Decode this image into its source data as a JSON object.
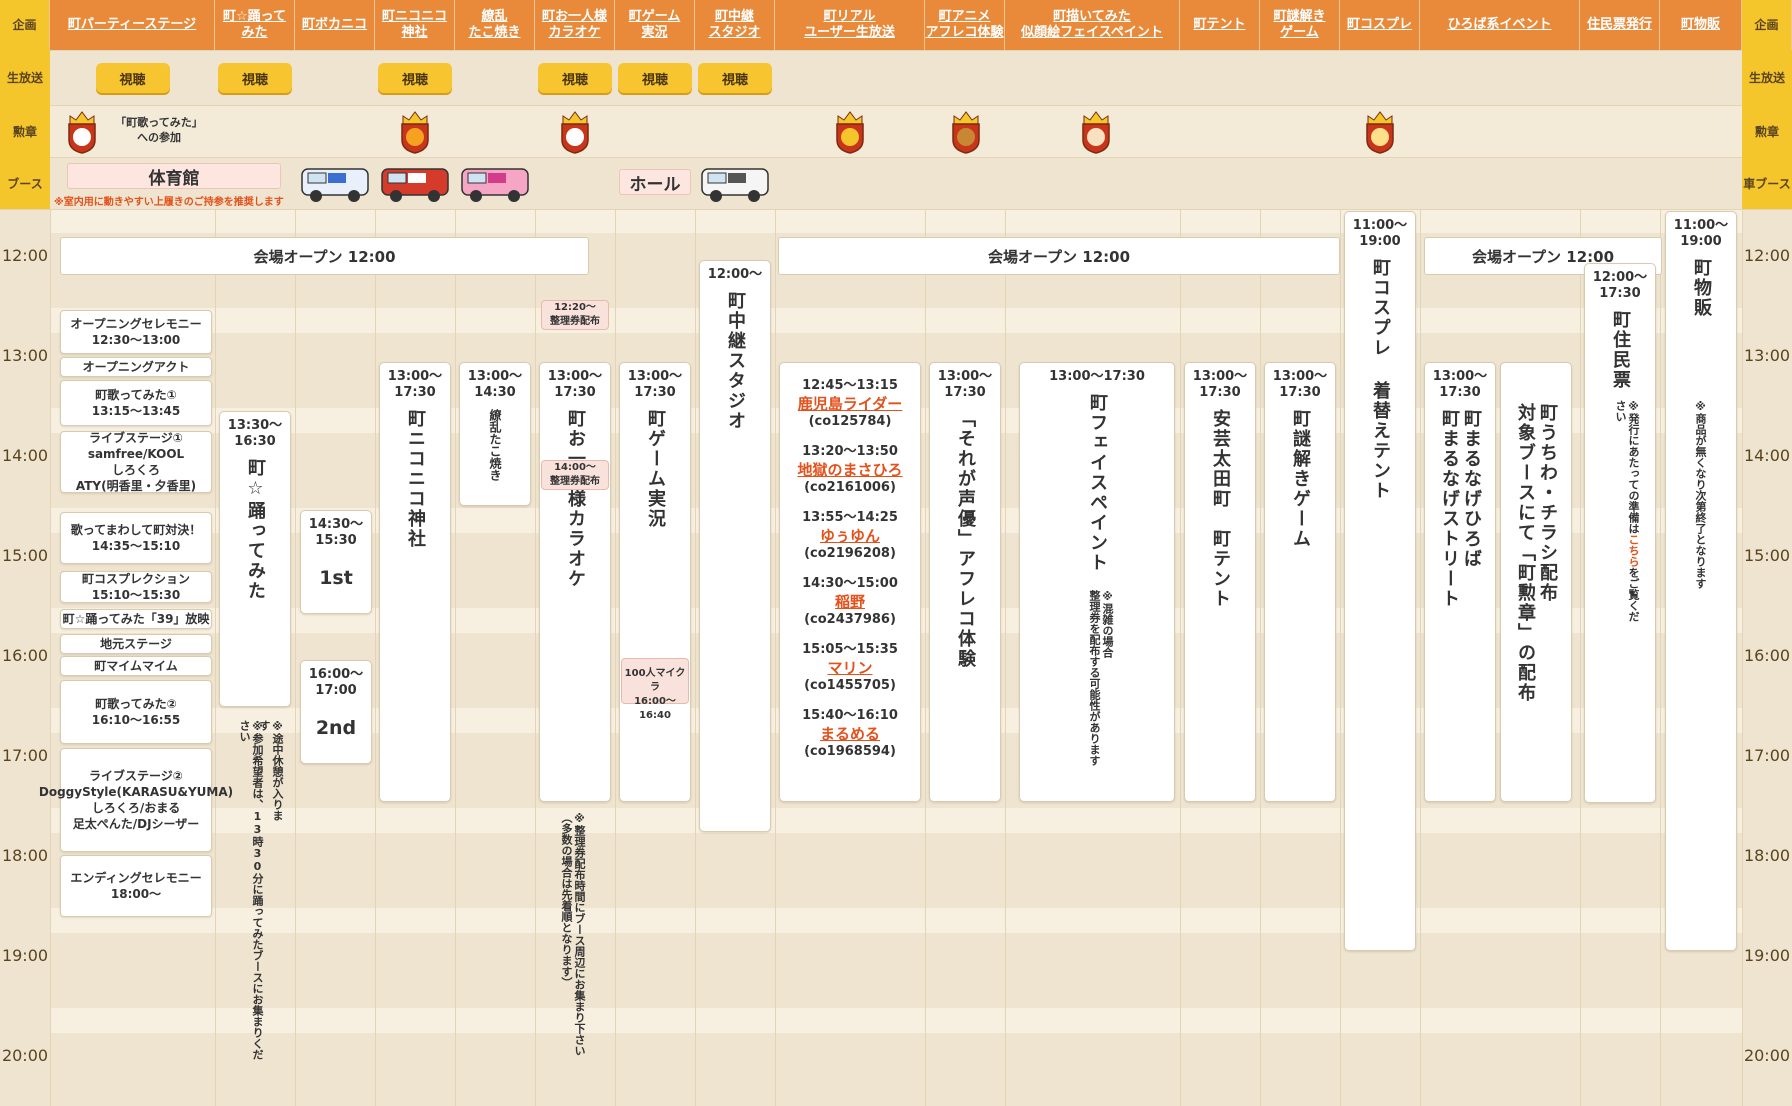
{
  "columns": [
    {
      "id": "party",
      "label": "町パーティーステージ"
    },
    {
      "id": "odotte",
      "label": "町☆踊って\nみた"
    },
    {
      "id": "vocaloid",
      "label": "町ボカニコ"
    },
    {
      "id": "jinja",
      "label": "町ニコニコ\n神社"
    },
    {
      "id": "takoyaki",
      "label": "繚乱\nたこ焼き"
    },
    {
      "id": "karaoke",
      "label": "町お一人様\nカラオケ"
    },
    {
      "id": "game",
      "label": "町ゲーム\n実況"
    },
    {
      "id": "chukei",
      "label": "町中継\nスタジオ"
    },
    {
      "id": "real",
      "label": "町リアル\nユーザー生放送"
    },
    {
      "id": "afureco",
      "label": "町アニメ\nアフレコ体験"
    },
    {
      "id": "facepaint",
      "label": "町描いてみた\n似顔絵フェイスペイント"
    },
    {
      "id": "tent",
      "label": "町テント"
    },
    {
      "id": "nazo",
      "label": "町謎解き\nゲーム"
    },
    {
      "id": "cosplay",
      "label": "町コスプレ"
    },
    {
      "id": "hiroba",
      "label": "ひろば系イベント"
    },
    {
      "id": "jumin",
      "label": "住民票発行"
    },
    {
      "id": "buppan",
      "label": "町物販"
    }
  ],
  "side": {
    "kikaku": "企画",
    "namahoso": "生放送",
    "kunsho": "勲章",
    "booth": "ブース",
    "car_booth": "車ブース"
  },
  "watch_label": "視聴",
  "kunsho_text": "「町歌ってみた」\nへの参加",
  "booth": {
    "gym": "体育館",
    "gym_note": "※室内用に動きやすい上履きのご持参を推奨します",
    "hall": "ホール"
  },
  "times": [
    "12:00",
    "13:00",
    "14:00",
    "15:00",
    "16:00",
    "17:00",
    "18:00",
    "19:00",
    "20:00"
  ],
  "open_label": "会場オープン 12:00",
  "party_items": [
    {
      "t": "オープニングセレモニー\n12:30〜13:00"
    },
    {
      "t": "オープニングアクト"
    },
    {
      "t": "町歌ってみた①\n13:15〜13:45"
    },
    {
      "t": "ライブステージ①\nsamfree/KOOL\nしろくろ\nATY(明香里・夕香里)"
    },
    {
      "t": "歌ってまわして町対決！\n14:35〜15:10"
    },
    {
      "t": "町コスプレクション\n15:10〜15:30"
    },
    {
      "t": "町☆踊ってみた「39」放映"
    },
    {
      "t": "地元ステージ"
    },
    {
      "t": "町マイムマイム"
    },
    {
      "t": "町歌ってみた②\n16:10〜16:55"
    },
    {
      "t": "ライブステージ②\nDoggyStyle(KARASU&YUMA)\nしろくろ/おまる\n足太ぺんた/DJシーザー"
    },
    {
      "t": "エンディングセレモニー\n18:00〜"
    }
  ],
  "odotte": {
    "time": "13:30〜\n16:30",
    "title": "町☆踊ってみた",
    "note1": "※途中休憩が入ります",
    "note2": "※参加希望者は、13時30分に踊ってみたブースにお集まりください"
  },
  "voca": {
    "s1time": "14:30〜\n15:30",
    "s1": "1st",
    "s2time": "16:00〜\n17:00",
    "s2": "2nd"
  },
  "jinja": {
    "time": "13:00〜\n17:30",
    "title": "町ニコニコ神社"
  },
  "tako": {
    "time": "13:00〜\n14:30",
    "title": "繚乱たこ焼き"
  },
  "karaoke": {
    "time": "13:00〜\n17:30",
    "title": "町お一人様カラオケ",
    "t1": "12:20〜\n整理券配布",
    "t2": "14:00〜\n整理券配布",
    "note": "※整理券配布時間にブース周辺にお集まり下さい（多数の場合は先着順となります）"
  },
  "game": {
    "time": "13:00〜\n17:30",
    "title": "町ゲーム実況",
    "sub": "100人マイクラ\n16:00〜16:40"
  },
  "chukei": {
    "time": "12:00〜",
    "title": "町中継スタジオ"
  },
  "real": [
    {
      "time": "12:45〜13:15",
      "name": "鹿児島ライダー",
      "co": "(co125784)"
    },
    {
      "time": "13:20〜13:50",
      "name": "地獄のまさひろ",
      "co": "(co2161006)"
    },
    {
      "time": "13:55〜14:25",
      "name": "ゆぅゆん",
      "co": "(co2196208)"
    },
    {
      "time": "14:30〜15:00",
      "name": "稲野",
      "co": "(co2437986)"
    },
    {
      "time": "15:05〜15:35",
      "name": "マリン",
      "co": "(co1455705)"
    },
    {
      "time": "15:40〜16:10",
      "name": "まるめる",
      "co": "(co1968594)"
    }
  ],
  "afureco": {
    "time": "13:00〜\n17:30",
    "title": "「それが声優」アフレコ体験"
  },
  "face": {
    "time": "13:00〜17:30",
    "title": "町フェイスペイント",
    "note": "※混雑の場合\n整理券を配布する可能性があります"
  },
  "tent": {
    "time": "13:00〜\n17:30",
    "title": "安芸太田町　町テント"
  },
  "nazo": {
    "time": "13:00〜\n17:30",
    "title": "町謎解きゲーム"
  },
  "cos": {
    "time": "11:00〜\n19:00",
    "title": "町コスプレ 着替えテント"
  },
  "hiroba": {
    "time": "13:00〜\n17:30",
    "t1": "町まるなげひろば\n町まるなげストリート",
    "t2": "町うちわ・チラシ配布\n対象ブースにて「町勲章」の配布"
  },
  "jumin": {
    "time": "12:00〜\n17:30",
    "title": "町住民票",
    "note_a": "※発行にあたっての準備は",
    "note_link": "こちら",
    "note_b": "をご覧ください"
  },
  "buppan": {
    "time": "11:00〜\n19:00",
    "title": "町物販",
    "note": "※商品が無くなり次第終了となります"
  },
  "colors": {
    "header": "#e88a3a",
    "side": "#f5c62b",
    "accent": "#e4511b",
    "bg": "#efe4cf"
  }
}
